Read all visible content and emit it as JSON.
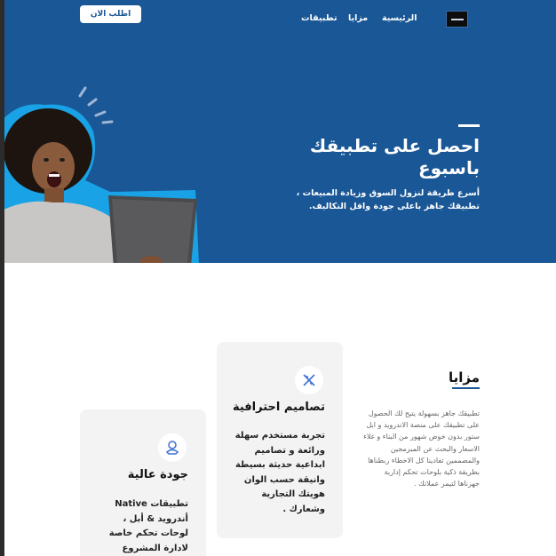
{
  "nav": {
    "cta_label": "اطلب الان",
    "links": [
      "الرئيسية",
      "مزايا",
      "تطبيقات"
    ],
    "logo_icon": "logo-mark"
  },
  "hero": {
    "title": "احصل على تطبيقك باسبوع",
    "subtitle": "أسرع طريقة لنزول السوق وزيادة المبيعات ، تطبيقك جاهز باعلى جودة واقل التكاليف.",
    "background": "#1a5796",
    "accent": "#19a3e6",
    "image": "woman-with-laptop"
  },
  "features": {
    "heading": "مزايا",
    "description": "تطبيقك جاهز بسهولة يتيح لك الحصول على تطبيقك على منصة الاندرويد و ابل ستور بدون خوض شهور من البناء و غلاء الاسعار والبحث عن المبرمجين والمصممين تفادينا كل الاخطاء ربطناها بطريقة ذكية بلوحات تحكم إدارية جهزناها لتيمر عملاتك .",
    "cards": [
      {
        "icon": "pencil-ruler-icon",
        "title": "تصاميم احترافية",
        "text": "تجربة مستخدم سهلة ورائعة و تصاميم ابداعية حديثة بسيطة وانيقة  حسب الوان هويتك التجارية وشعارك ."
      },
      {
        "icon": "quality-badge-icon",
        "title": "جودة عالية",
        "text": "تطبيقات Native أندرويد & أبل ، لوحات تحكم خاصة لادارة المشروع ولوحات"
      }
    ]
  }
}
